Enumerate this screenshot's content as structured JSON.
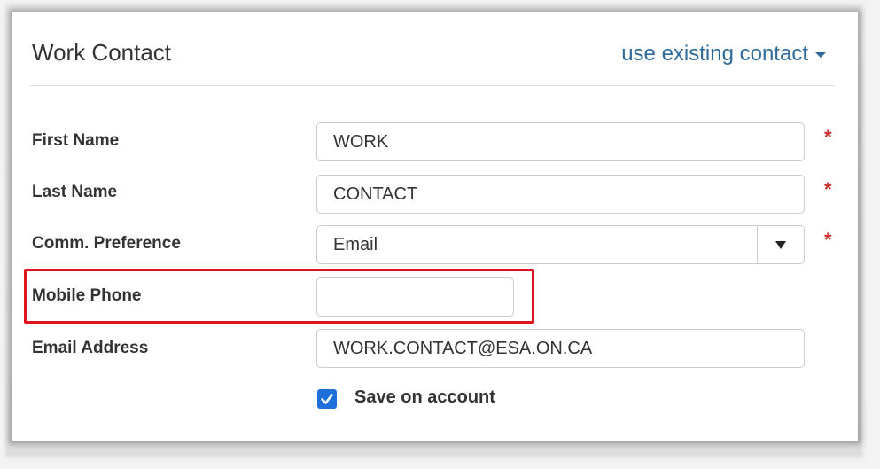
{
  "panel": {
    "title": "Work Contact",
    "use_existing_label": "use existing contact"
  },
  "fields": {
    "first_name": {
      "label": "First Name",
      "value": "WORK",
      "required": "*"
    },
    "last_name": {
      "label": "Last Name",
      "value": "CONTACT",
      "required": "*"
    },
    "comm_preference": {
      "label": "Comm. Preference",
      "value": "Email",
      "required": "*"
    },
    "mobile_phone": {
      "label": "Mobile Phone",
      "value": ""
    },
    "email": {
      "label": "Email Address",
      "value": "WORK.CONTACT@ESA.ON.CA"
    }
  },
  "save_on_account": {
    "label": "Save on account",
    "checked": true
  },
  "colors": {
    "accent": "#2c6b9c",
    "required": "#c9302c",
    "highlight": "#e0141e",
    "checkbox": "#1e6fd9"
  }
}
